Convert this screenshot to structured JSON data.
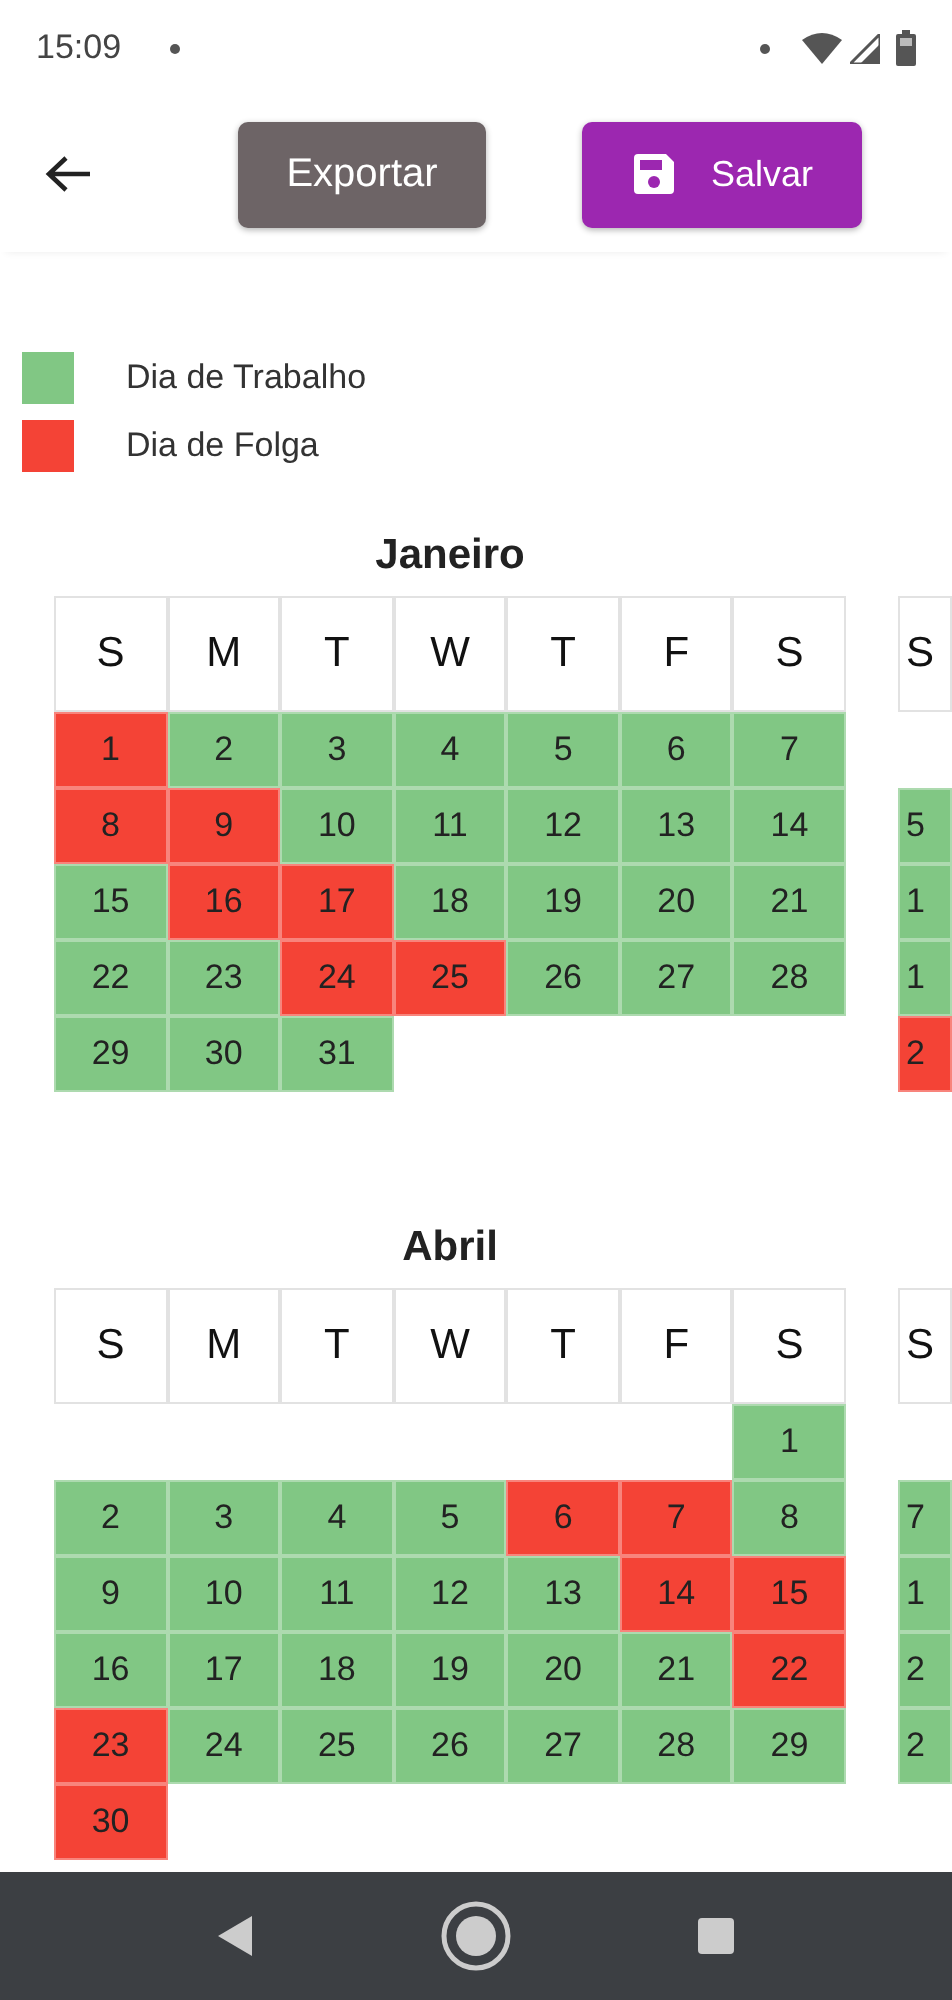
{
  "status_bar": {
    "time": "15:09"
  },
  "toolbar": {
    "buttons": [
      {
        "label": "Exportar",
        "kind": "export"
      },
      {
        "label": "Salvar",
        "kind": "save"
      }
    ]
  },
  "legend": [
    {
      "label": "Dia de Trabalho",
      "color": "#81c784"
    },
    {
      "label": "Dia de Folga",
      "color": "#f44336"
    }
  ],
  "month_rows": [
    {
      "months": [
        {
          "name": "Janeiro",
          "weekdays": [
            "S",
            "M",
            "T",
            "W",
            "T",
            "F",
            "S"
          ],
          "weeks": [
            [
              {
                "day": "1",
                "kind": "off"
              },
              {
                "day": "2",
                "kind": "work"
              },
              {
                "day": "3",
                "kind": "work"
              },
              {
                "day": "4",
                "kind": "work"
              },
              {
                "day": "5",
                "kind": "work"
              },
              {
                "day": "6",
                "kind": "work"
              },
              {
                "day": "7",
                "kind": "work"
              }
            ],
            [
              {
                "day": "8",
                "kind": "off"
              },
              {
                "day": "9",
                "kind": "off"
              },
              {
                "day": "10",
                "kind": "work"
              },
              {
                "day": "11",
                "kind": "work"
              },
              {
                "day": "12",
                "kind": "work"
              },
              {
                "day": "13",
                "kind": "work"
              },
              {
                "day": "14",
                "kind": "work"
              }
            ],
            [
              {
                "day": "15",
                "kind": "work"
              },
              {
                "day": "16",
                "kind": "off"
              },
              {
                "day": "17",
                "kind": "off"
              },
              {
                "day": "18",
                "kind": "work"
              },
              {
                "day": "19",
                "kind": "work"
              },
              {
                "day": "20",
                "kind": "work"
              },
              {
                "day": "21",
                "kind": "work"
              }
            ],
            [
              {
                "day": "22",
                "kind": "work"
              },
              {
                "day": "23",
                "kind": "work"
              },
              {
                "day": "24",
                "kind": "off"
              },
              {
                "day": "25",
                "kind": "off"
              },
              {
                "day": "26",
                "kind": "work"
              },
              {
                "day": "27",
                "kind": "work"
              },
              {
                "day": "28",
                "kind": "work"
              }
            ],
            [
              {
                "day": "29",
                "kind": "work"
              },
              {
                "day": "30",
                "kind": "work"
              },
              {
                "day": "31",
                "kind": "work"
              }
            ]
          ]
        },
        {
          "weekdays": [
            "S"
          ],
          "weeks": [
            [
              {
                "kind": "blank"
              }
            ],
            [
              {
                "day": "5",
                "kind": "work"
              }
            ],
            [
              {
                "day": "1",
                "kind": "work"
              }
            ],
            [
              {
                "day": "1",
                "kind": "work"
              }
            ],
            [
              {
                "day": "2",
                "kind": "off"
              }
            ]
          ]
        }
      ]
    },
    {
      "months": [
        {
          "name": "Abril",
          "weekdays": [
            "S",
            "M",
            "T",
            "W",
            "T",
            "F",
            "S"
          ],
          "weeks": [
            [
              {
                "kind": "blank"
              },
              {
                "kind": "blank"
              },
              {
                "kind": "blank"
              },
              {
                "kind": "blank"
              },
              {
                "kind": "blank"
              },
              {
                "kind": "blank"
              },
              {
                "day": "1",
                "kind": "work"
              }
            ],
            [
              {
                "day": "2",
                "kind": "work"
              },
              {
                "day": "3",
                "kind": "work"
              },
              {
                "day": "4",
                "kind": "work"
              },
              {
                "day": "5",
                "kind": "work"
              },
              {
                "day": "6",
                "kind": "off"
              },
              {
                "day": "7",
                "kind": "off"
              },
              {
                "day": "8",
                "kind": "work"
              }
            ],
            [
              {
                "day": "9",
                "kind": "work"
              },
              {
                "day": "10",
                "kind": "work"
              },
              {
                "day": "11",
                "kind": "work"
              },
              {
                "day": "12",
                "kind": "work"
              },
              {
                "day": "13",
                "kind": "work"
              },
              {
                "day": "14",
                "kind": "off"
              },
              {
                "day": "15",
                "kind": "off"
              }
            ],
            [
              {
                "day": "16",
                "kind": "work"
              },
              {
                "day": "17",
                "kind": "work"
              },
              {
                "day": "18",
                "kind": "work"
              },
              {
                "day": "19",
                "kind": "work"
              },
              {
                "day": "20",
                "kind": "work"
              },
              {
                "day": "21",
                "kind": "work"
              },
              {
                "day": "22",
                "kind": "off"
              }
            ],
            [
              {
                "day": "23",
                "kind": "off"
              },
              {
                "day": "24",
                "kind": "work"
              },
              {
                "day": "25",
                "kind": "work"
              },
              {
                "day": "26",
                "kind": "work"
              },
              {
                "day": "27",
                "kind": "work"
              },
              {
                "day": "28",
                "kind": "work"
              },
              {
                "day": "29",
                "kind": "work"
              }
            ],
            [
              {
                "day": "30",
                "kind": "off"
              }
            ]
          ]
        },
        {
          "weekdays": [
            "S"
          ],
          "weeks": [
            [
              {
                "kind": "blank"
              }
            ],
            [
              {
                "day": "7",
                "kind": "work"
              }
            ],
            [
              {
                "day": "1",
                "kind": "work"
              }
            ],
            [
              {
                "day": "2",
                "kind": "work"
              }
            ],
            [
              {
                "day": "2",
                "kind": "work"
              }
            ]
          ]
        }
      ]
    }
  ]
}
